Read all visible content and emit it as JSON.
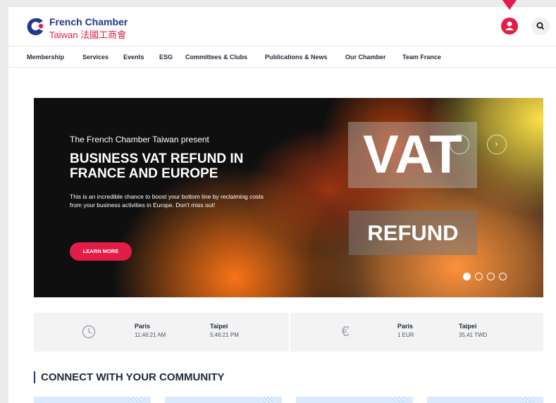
{
  "header": {
    "logo": {
      "line1": "French Chamber",
      "line2": "Taiwan 法國工商會"
    },
    "user_icon": "user-icon",
    "search_icon": "search-icon"
  },
  "nav": {
    "items": [
      {
        "label": "Membership"
      },
      {
        "label": "Services"
      },
      {
        "label": "Events"
      },
      {
        "label": "ESG"
      },
      {
        "label": "Committees & Clubs"
      },
      {
        "label": "Publications & News"
      },
      {
        "label": "Our Chamber"
      },
      {
        "label": "Team France"
      }
    ]
  },
  "hero": {
    "kicker": "The French Chamber Taiwan present",
    "title": "BUSINESS VAT REFUND IN FRANCE AND EUROPE",
    "body": "This is an incredible chance to boost your bottom line by reclaiming costs from your business activities in Europe. Don't miss out!",
    "button_label": "LEARN MORE",
    "image_text_1": "VAT",
    "image_text_2": "REFUND",
    "next_glyph": "›",
    "slide_count": 4,
    "active_slide": 1
  },
  "time_strip": {
    "icon": "clock-icon",
    "cities": [
      {
        "city": "Paris",
        "value": "11:46:21 AM"
      },
      {
        "city": "Taipei",
        "value": "5:46:21 PM"
      }
    ]
  },
  "currency_strip": {
    "icon": "euro-icon",
    "symbol": "€",
    "cities": [
      {
        "city": "Paris",
        "value": "1 EUR"
      },
      {
        "city": "Taipei",
        "value": "35,41 TWD"
      }
    ]
  },
  "section": {
    "title": "CONNECT WITH YOUR COMMUNITY"
  },
  "colors": {
    "brand_red": "#e11d48",
    "brand_blue": "#1e3a8a"
  }
}
